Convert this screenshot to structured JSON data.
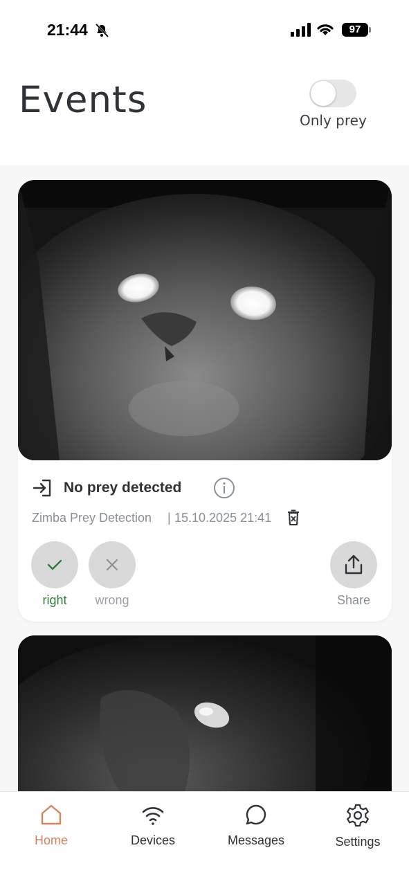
{
  "status_bar": {
    "time": "21:44",
    "battery": "97"
  },
  "header": {
    "title": "Events",
    "toggle_label": "Only prey"
  },
  "event": {
    "status": "No prey detected",
    "device": "Zimba Prey Detection",
    "separator": "|",
    "datetime": "15.10.2025 21:41",
    "feedback_right": "right",
    "feedback_wrong": "wrong",
    "share": "Share"
  },
  "nav": {
    "home": "Home",
    "devices": "Devices",
    "messages": "Messages",
    "settings": "Settings"
  },
  "colors": {
    "accent": "#d9805f",
    "right_green": "#2f7d31",
    "text": "#2f3338",
    "muted": "#8a9097"
  }
}
